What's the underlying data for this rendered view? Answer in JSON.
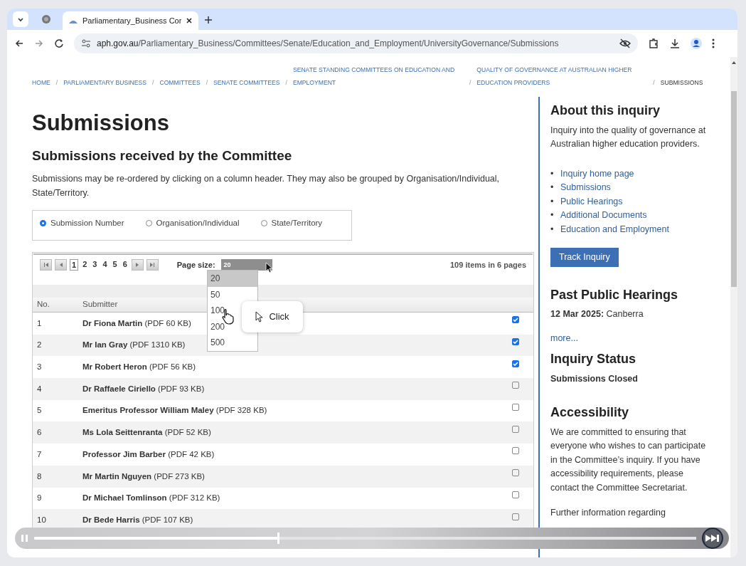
{
  "browser": {
    "tab_title": "Parliamentary_Business Cor",
    "url_domain": "aph.gov.au",
    "url_path": "/Parliamentary_Business/Committees/Senate/Education_and_Employment/UniversityGovernance/Submissions"
  },
  "breadcrumbs": [
    {
      "label": "HOME",
      "current": false
    },
    {
      "label": "PARLIAMENTARY BUSINESS",
      "current": false
    },
    {
      "label": "COMMITTEES",
      "current": false
    },
    {
      "label": "SENATE COMMITTEES",
      "current": false
    },
    {
      "label": "SENATE STANDING COMMITTEES ON EDUCATION AND EMPLOYMENT",
      "current": false
    },
    {
      "label": "QUALITY OF GOVERNANCE AT AUSTRALIAN HIGHER EDUCATION PROVIDERS",
      "current": false
    },
    {
      "label": "SUBMISSIONS",
      "current": true
    }
  ],
  "breadcrumb_separator": "/",
  "heading": "Submissions",
  "subheading": "Submissions received by the Committee",
  "intro": "Submissions may be re-ordered by clicking on a column header. They may also be grouped by Organisation/Individual, State/Territory.",
  "group_by": [
    {
      "label": "Submission Number",
      "selected": true
    },
    {
      "label": "Organisation/Individual",
      "selected": false
    },
    {
      "label": "State/Territory",
      "selected": false
    }
  ],
  "pager": {
    "pages": [
      {
        "label": "1",
        "selected": true
      },
      {
        "label": "2",
        "selected": false
      },
      {
        "label": "3",
        "selected": false
      },
      {
        "label": "4",
        "selected": false
      },
      {
        "label": "5",
        "selected": false
      },
      {
        "label": "6",
        "selected": false
      }
    ],
    "page_size_label": "Page size:",
    "page_size_value": "20",
    "summary": "109 items in 6 pages"
  },
  "page_size_options": [
    {
      "label": "20",
      "selected": true
    },
    {
      "label": "50",
      "selected": false
    },
    {
      "label": "100",
      "selected": false
    },
    {
      "label": "200",
      "selected": false
    },
    {
      "label": "500",
      "selected": false
    }
  ],
  "table": {
    "columns": [
      "No.",
      "Submitter"
    ],
    "rows": [
      {
        "no": "1",
        "name": "Dr Fiona Martin",
        "file": "(PDF 60 KB)",
        "checked": true
      },
      {
        "no": "2",
        "name": "Mr Ian Gray",
        "file": "(PDF 1310 KB)",
        "checked": true
      },
      {
        "no": "3",
        "name": "Mr Robert Heron",
        "file": "(PDF 56 KB)",
        "checked": true
      },
      {
        "no": "4",
        "name": "Dr Raffaele Ciriello",
        "file": "(PDF 93 KB)",
        "checked": false
      },
      {
        "no": "5",
        "name": "Emeritus Professor William Maley",
        "file": "(PDF 328 KB)",
        "checked": false
      },
      {
        "no": "6",
        "name": "Ms Lola Seittenranta",
        "file": "(PDF 52 KB)",
        "checked": false
      },
      {
        "no": "7",
        "name": "Professor Jim Barber",
        "file": "(PDF 42 KB)",
        "checked": false
      },
      {
        "no": "8",
        "name": "Mr Martin Nguyen",
        "file": "(PDF 273 KB)",
        "checked": false
      },
      {
        "no": "9",
        "name": "Dr Michael Tomlinson",
        "file": "(PDF 312 KB)",
        "checked": false
      },
      {
        "no": "10",
        "name": "Dr Bede Harris",
        "file": "(PDF 107 KB)",
        "checked": false
      }
    ]
  },
  "tooltip": "Click",
  "sidebar": {
    "about_title": "About this inquiry",
    "about_text": "Inquiry into the quality of governance at Australian higher education providers.",
    "link_bullet": "•",
    "links": [
      "Inquiry home page",
      "Submissions",
      "Public Hearings",
      "Additional Documents",
      "Education and Employment"
    ],
    "track_button": "Track Inquiry",
    "hearings_title": "Past Public Hearings",
    "hearing_date": "12 Mar 2025:",
    "hearing_place": "Canberra",
    "more_link": "more...",
    "status_title": "Inquiry Status",
    "status": "Submissions Closed",
    "accessibility_title": "Accessibility",
    "accessibility_text": "We are committed to ensuring that everyone who wishes to can participate in the Committee’s inquiry. If you have accessibility requirements, please contact the Committee Secretariat.",
    "further_text": "Further information regarding"
  },
  "player": {
    "level": 0.37
  }
}
